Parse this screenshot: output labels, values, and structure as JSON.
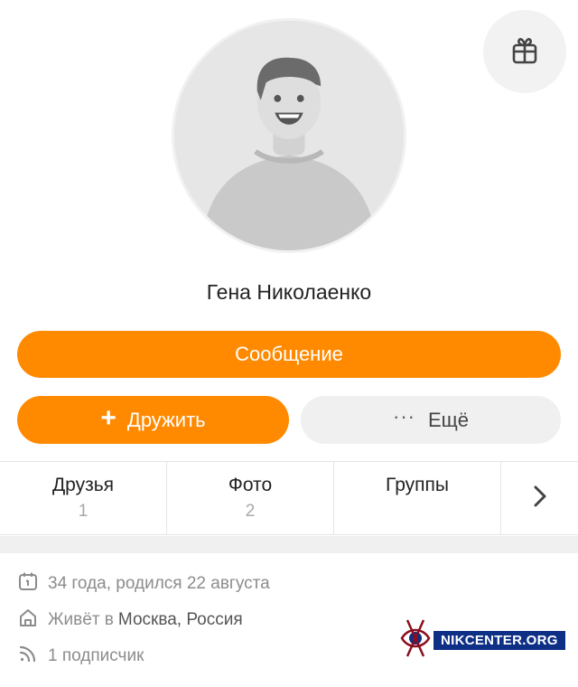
{
  "profile": {
    "name": "Гена Николаенко"
  },
  "actions": {
    "message_label": "Сообщение",
    "add_friend_label": "Дружить",
    "more_label": "Ещё"
  },
  "stats": [
    {
      "label": "Друзья",
      "count": "1"
    },
    {
      "label": "Фото",
      "count": "2"
    },
    {
      "label": "Группы",
      "count": ""
    }
  ],
  "info": {
    "birthday": "34 года, родился 22 августа",
    "lives_prefix": "Живёт в",
    "lives_place": "Москва, Россия",
    "subscribers": "1 подписчик"
  },
  "watermark": {
    "text": "NIKCENTER.ORG"
  },
  "icons": [
    "gift-icon",
    "plus-icon",
    "more-dots-icon",
    "chevron-right-icon",
    "calendar-icon",
    "home-icon",
    "rss-icon",
    "eye-logo-icon"
  ],
  "colors": {
    "accent": "#ff8a00",
    "secondary_button": "#f0f0f0",
    "watermark_bg": "#0e2f86"
  }
}
